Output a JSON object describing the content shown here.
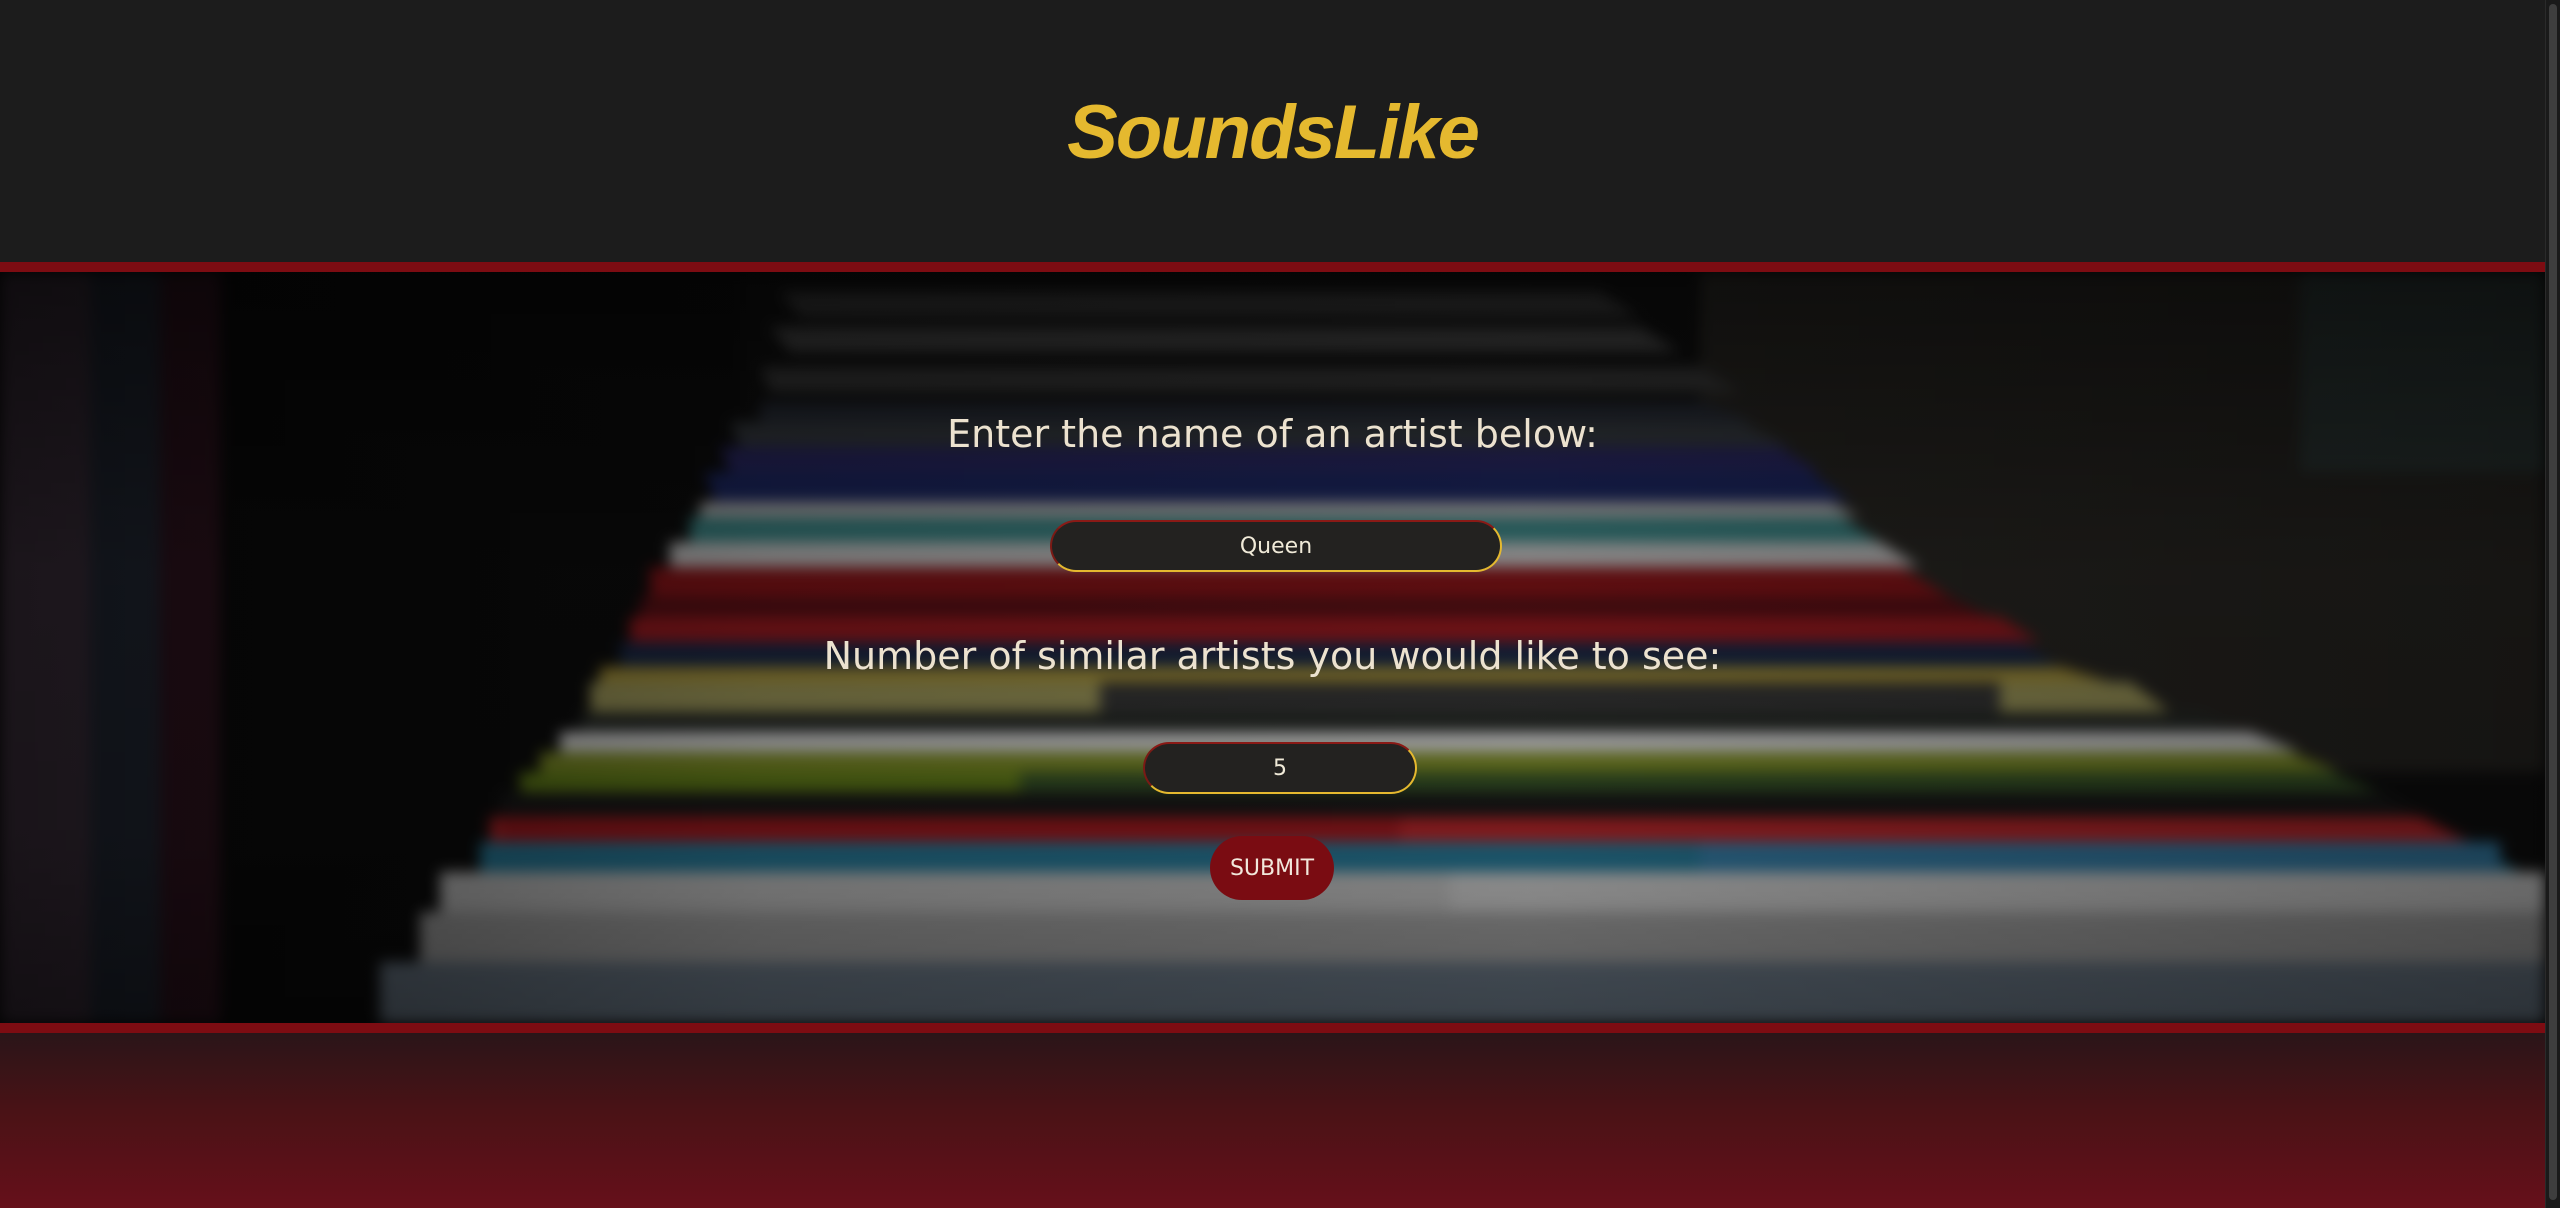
{
  "header": {
    "brand": "SoundsLike"
  },
  "form": {
    "artist_prompt": "Enter the name of an artist below:",
    "artist_value": "Queen",
    "count_prompt": "Number of similar artists you would like to see:",
    "count_value": "5",
    "submit_label": "SUBMIT"
  },
  "colors": {
    "brand": "#e5b92f",
    "accent_red": "#7d0c12",
    "background": "#1c1c1c"
  }
}
